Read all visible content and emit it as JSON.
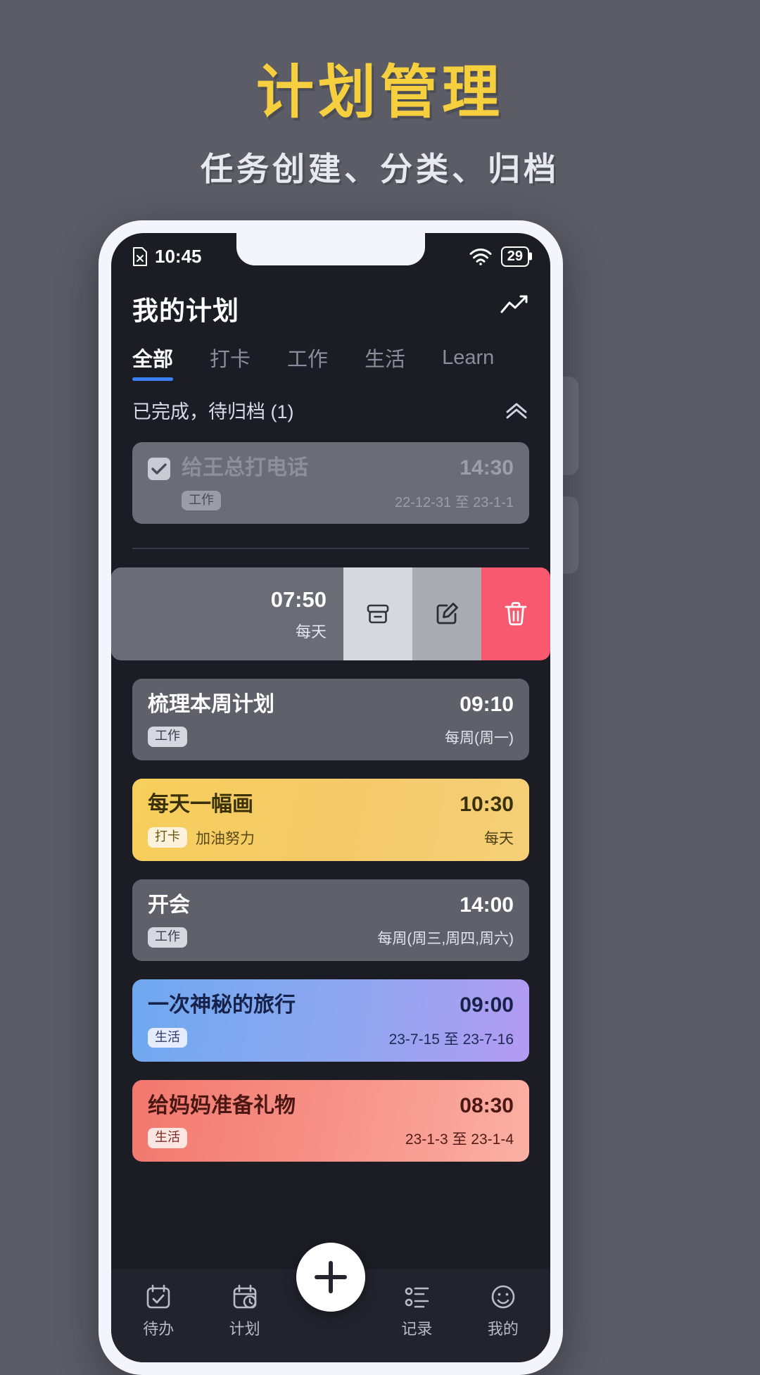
{
  "promo": {
    "title": "计划管理",
    "subtitle": "任务创建、分类、归档",
    "title_color": "#f5cf3d",
    "subtitle_color": "#e8e9ef",
    "background_color": "#5c5c66"
  },
  "status_bar": {
    "time": "10:45",
    "doc_icon": "document-x-icon",
    "wifi_icon": "wifi-icon",
    "battery_level": "29"
  },
  "header": {
    "title": "我的计划",
    "chart_icon": "line-chart-icon"
  },
  "tabs": [
    {
      "label": "全部",
      "active": true
    },
    {
      "label": "打卡",
      "active": false
    },
    {
      "label": "工作",
      "active": false
    },
    {
      "label": "生活",
      "active": false
    },
    {
      "label": "Learn",
      "active": false
    }
  ],
  "section": {
    "title": "已完成，待归档 (1)",
    "collapse_icon": "chevron-double-up-icon"
  },
  "archived_task": {
    "checked": true,
    "title": "给王总打电话",
    "tag": "工作",
    "time": "14:30",
    "date_range": "22-12-31 至 23-1-1"
  },
  "swipe_row": {
    "time": "07:50",
    "repeat": "每天",
    "actions": [
      {
        "name": "archive",
        "icon": "archive-box-icon"
      },
      {
        "name": "edit",
        "icon": "pencil-square-icon"
      },
      {
        "name": "delete",
        "icon": "trash-icon"
      }
    ]
  },
  "tasks": [
    {
      "title": "梳理本周计划",
      "tag": "工作",
      "note": "",
      "time": "09:10",
      "repeat": "每周(周一)",
      "style": "grey"
    },
    {
      "title": "每天一幅画",
      "tag": "打卡",
      "note": "加油努力",
      "time": "10:30",
      "repeat": "每天",
      "style": "yellow"
    },
    {
      "title": "开会",
      "tag": "工作",
      "note": "",
      "time": "14:00",
      "repeat": "每周(周三,周四,周六)",
      "style": "grey"
    },
    {
      "title": "一次神秘的旅行",
      "tag": "生活",
      "note": "",
      "time": "09:00",
      "repeat": "23-7-15 至 23-7-16",
      "style": "blue"
    },
    {
      "title": "给妈妈准备礼物",
      "tag": "生活",
      "note": "",
      "time": "08:30",
      "repeat": "23-1-3 至 23-1-4",
      "style": "red"
    }
  ],
  "bottom_nav": [
    {
      "label": "待办",
      "icon": "calendar-check-icon"
    },
    {
      "label": "计划",
      "icon": "calendar-clock-icon"
    },
    {
      "label": "记录",
      "icon": "timeline-icon"
    },
    {
      "label": "我的",
      "icon": "smiley-face-icon"
    }
  ],
  "fab": {
    "icon": "plus-icon"
  }
}
